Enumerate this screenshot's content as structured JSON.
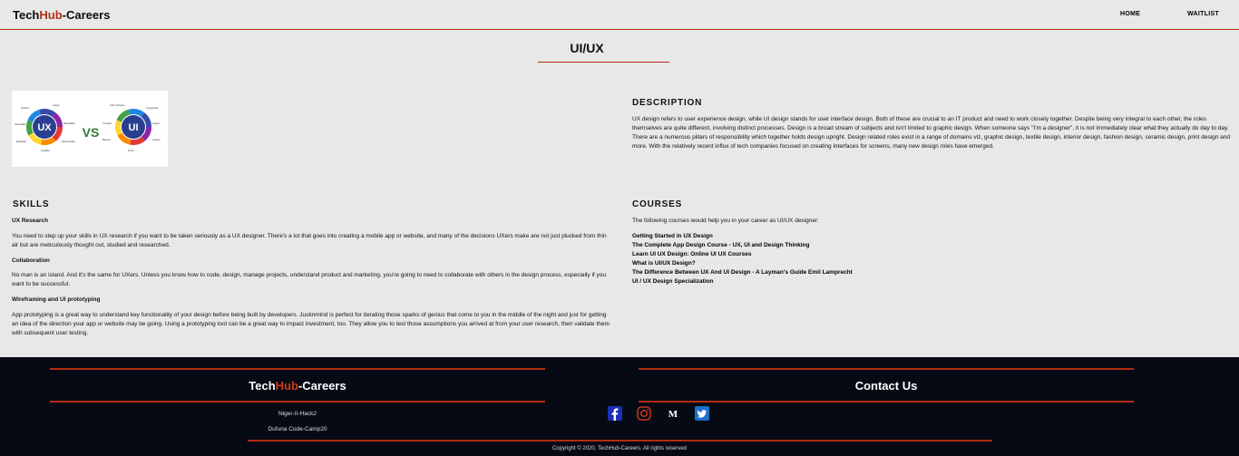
{
  "header": {
    "brand": {
      "prefix": "Tech",
      "highlight": "Hub",
      "suffix": "-Careers"
    },
    "nav": {
      "home": "HOME",
      "waitlist": "WAITLIST"
    }
  },
  "page": {
    "title": "UI/UX"
  },
  "hero_image": {
    "left_label": "UX",
    "vs_label": "VS",
    "right_label": "UI",
    "left_segments": [
      "Intuitive",
      "Useful",
      "Accessible",
      "Marketable",
      "Desirable",
      "Discoverable",
      "Credible"
    ],
    "right_segments": [
      "Color Scheme",
      "Typography",
      "Contrast",
      "Layout",
      "Buttons",
      "Images",
      "Fonts"
    ]
  },
  "description": {
    "heading": "DESCRIPTION",
    "text": "UX design refers to user experience design, while UI design stands for user interface design. Both of these are crucial to an IT product and need to work closely together. Despite being very integral to each other, the roles themselves are quite different, involving distinct processes. Design is a broad stream of subjects and isn't limited to graphic design. When someone says \"I'm a designer\", it is not immediately clear what they actually do day to day. There are a numerous pillars of responsibility which together holds design upright. Design related roles exist in a range of domains viz, graphic design, textile design, interior design, fashion design, ceramic design, print design and more. With the relatively recent influx of tech companies focused on creating interfaces for screens, many new design roles have emerged."
  },
  "skills": {
    "heading": "SKILLS",
    "items": [
      {
        "title": "UX Research",
        "text": "You need to step up your skills in UX research if you want to be taken seriously as a UX designer. There's a lot that goes into creating a mobile app or website, and many of the decisions UXers make are not just plucked from thin air but are meticulously thought out, studied and researched."
      },
      {
        "title": "Collaboration",
        "text": "No man is an island. And it's the same for UXers. Unless you know how to code, design, manage projects, understand product and marketing, you're going to need to collaborate with others in the design process, especially if you want to be successful."
      },
      {
        "title": "Wireframing and UI prototyping",
        "text": "App prototyping is a great way to understand key functionality of your design before being built by developers. Justinmind is perfect for iterating those sparks of genius that come to you in the middle of the night and just for getting an idea of the direction your app or website may be going. Using a prototyping tool can be a great way to impact investment, too. They allow you to test those assumptions you arrived at from your user research, then validate them with subsequent user testing."
      }
    ]
  },
  "courses": {
    "heading": "COURSES",
    "intro": "The following courses would help you in your career as UI/UX designer:",
    "items": [
      "Getting Started in UX Design",
      "The Complete App Design Course - UX, UI and Design Thinking",
      "Learn UI UX Design: Online UI UX Courses",
      "What is UI/UX Design?",
      "The Difference Between UX And UI Design - A Layman's Guide Emil Lamprecht",
      "UI / UX Design Specialization"
    ]
  },
  "footer": {
    "brand": {
      "prefix": "Tech",
      "highlight": "Hub",
      "suffix": "-Careers"
    },
    "contact_heading": "Contact Us",
    "lines": [
      "Niger-II-Hack2",
      "Dufuna Code-Camp20"
    ],
    "copyright": "Copyright © 2020, TechHub-Careers. All rights reserved",
    "social_icons": [
      "facebook-icon",
      "instagram-icon",
      "medium-icon",
      "twitter-icon"
    ]
  },
  "colors": {
    "accent": "#b32d12",
    "footer_bg": "#050a14",
    "page_bg": "#e8e8e8",
    "facebook": "#1b2fb5",
    "instagram": "#c1351c",
    "twitter": "#1d6fc9"
  }
}
